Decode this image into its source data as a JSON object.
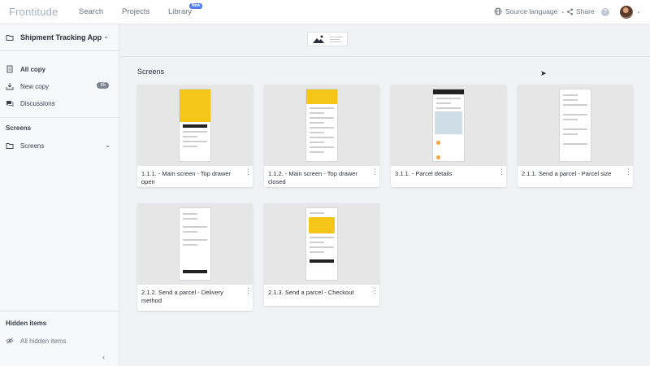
{
  "topbar": {
    "logo": "Frontitude",
    "nav": {
      "search": "Search",
      "projects": "Projects",
      "library": "Library",
      "library_badge": "New"
    },
    "source_language": "Source language",
    "share": "Share"
  },
  "sidebar": {
    "project_name": "Shipment Tracking App",
    "items": [
      {
        "label": "All copy"
      },
      {
        "label": "New copy",
        "count": "95"
      },
      {
        "label": "Discussions"
      }
    ],
    "screens_section": "Screens",
    "screens_item": "Screens",
    "hidden_section": "Hidden items",
    "hidden_item": "All hidden items"
  },
  "main": {
    "heading": "Screens",
    "cards": [
      {
        "title": "1.1.1. - Main screen - Top drawer open"
      },
      {
        "title": "1.1.2. - Main screen - Top drawer closed"
      },
      {
        "title": "3.1.1. - Parcel details"
      },
      {
        "title": "2.1.1. Send a parcel - Parcel size"
      },
      {
        "title": "2.1.2. Send a parcel - Delivery method"
      },
      {
        "title": "2.1.3. Send a parcel - Checkout"
      }
    ]
  },
  "colors": {
    "accent": "#4f7cf0",
    "brand_yellow": "#f5c518",
    "sidebar_bg": "#f7f8fa",
    "main_bg": "#f1f2f5"
  }
}
